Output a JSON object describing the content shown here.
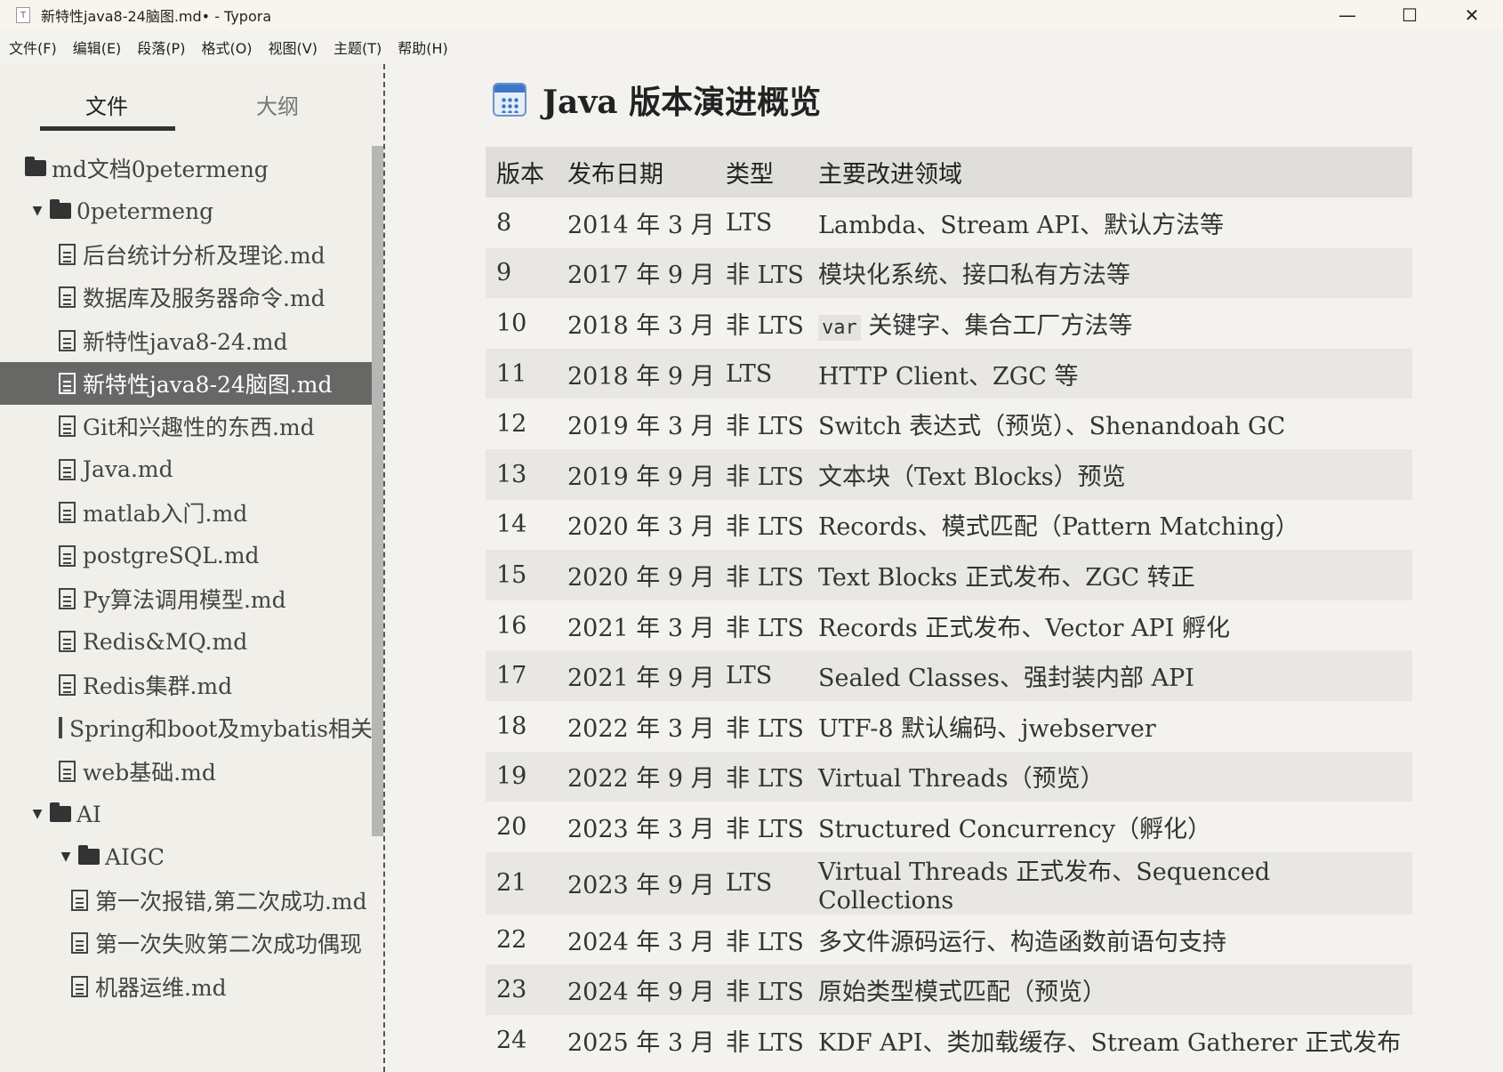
{
  "window": {
    "icon_letter": "T",
    "title": "新特性java8-24脑图.md• - Typora",
    "minimize": "—",
    "maximize": "☐",
    "close": "✕"
  },
  "menu": [
    "文件(F)",
    "编辑(E)",
    "段落(P)",
    "格式(O)",
    "视图(V)",
    "主题(T)",
    "帮助(H)"
  ],
  "sidebar": {
    "tabs": {
      "files": "文件",
      "outline": "大纲"
    },
    "tree": [
      {
        "type": "folder",
        "level": 0,
        "caret": "",
        "label": "md文档0petermeng"
      },
      {
        "type": "folder",
        "level": 1,
        "caret": "▼",
        "label": "0petermeng"
      },
      {
        "type": "file",
        "level": 2,
        "label": "后台统计分析及理论.md"
      },
      {
        "type": "file",
        "level": 2,
        "label": "数据库及服务器命令.md"
      },
      {
        "type": "file",
        "level": 2,
        "label": "新特性java8-24.md"
      },
      {
        "type": "file",
        "level": 2,
        "label": "新特性java8-24脑图.md",
        "selected": true
      },
      {
        "type": "file",
        "level": 2,
        "label": "Git和兴趣性的东西.md"
      },
      {
        "type": "file",
        "level": 2,
        "label": "Java.md"
      },
      {
        "type": "file",
        "level": 2,
        "label": "matlab入门.md"
      },
      {
        "type": "file",
        "level": 2,
        "label": "postgreSQL.md"
      },
      {
        "type": "file",
        "level": 2,
        "label": "Py算法调用模型.md"
      },
      {
        "type": "file",
        "level": 2,
        "label": "Redis&MQ.md"
      },
      {
        "type": "file",
        "level": 2,
        "label": "Redis集群.md"
      },
      {
        "type": "file",
        "level": 2,
        "label": "Spring和boot及mybatis相关"
      },
      {
        "type": "file",
        "level": 2,
        "label": "web基础.md"
      },
      {
        "type": "folder",
        "level": 1,
        "caret": "▼",
        "label": "AI"
      },
      {
        "type": "folder",
        "level": 2,
        "caret": "▼",
        "label": "AIGC"
      },
      {
        "type": "file",
        "level": 3,
        "label": "第一次报错,第二次成功.md"
      },
      {
        "type": "file",
        "level": 3,
        "label": "第一次失败第二次成功偶现"
      },
      {
        "type": "file",
        "level": 3,
        "label": "机器运维.md"
      }
    ]
  },
  "document": {
    "heading": "Java 版本演进概览",
    "table": {
      "headers": [
        "版本",
        "发布日期",
        "类型",
        "主要改进领域"
      ],
      "rows": [
        [
          "8",
          "2014 年 3 月",
          "LTS",
          "Lambda、Stream API、默认方法等"
        ],
        [
          "9",
          "2017 年 9 月",
          "非 LTS",
          "模块化系统、接口私有方法等"
        ],
        [
          "10",
          "2018 年 3 月",
          "非 LTS",
          "var|关键字、集合工厂方法等"
        ],
        [
          "11",
          "2018 年 9 月",
          "LTS",
          "HTTP Client、ZGC 等"
        ],
        [
          "12",
          "2019 年 3 月",
          "非 LTS",
          "Switch 表达式（预览）、Shenandoah GC"
        ],
        [
          "13",
          "2019 年 9 月",
          "非 LTS",
          "文本块（Text Blocks）预览"
        ],
        [
          "14",
          "2020 年 3 月",
          "非 LTS",
          "Records、模式匹配（Pattern Matching）"
        ],
        [
          "15",
          "2020 年 9 月",
          "非 LTS",
          "Text Blocks 正式发布、ZGC 转正"
        ],
        [
          "16",
          "2021 年 3 月",
          "非 LTS",
          "Records 正式发布、Vector API 孵化"
        ],
        [
          "17",
          "2021 年 9 月",
          "LTS",
          "Sealed Classes、强封装内部 API"
        ],
        [
          "18",
          "2022 年 3 月",
          "非 LTS",
          "UTF-8 默认编码、jwebserver"
        ],
        [
          "19",
          "2022 年 9 月",
          "非 LTS",
          "Virtual Threads（预览）"
        ],
        [
          "20",
          "2023 年 3 月",
          "非 LTS",
          "Structured Concurrency（孵化）"
        ],
        [
          "21",
          "2023 年 9 月",
          "LTS",
          "Virtual Threads 正式发布、Sequenced Collections"
        ],
        [
          "22",
          "2024 年 3 月",
          "非 LTS",
          "多文件源码运行、构造函数前语句支持"
        ],
        [
          "23",
          "2024 年 9 月",
          "非 LTS",
          "原始类型模式匹配（预览）"
        ],
        [
          "24",
          "2025 年 3 月",
          "非 LTS",
          "KDF API、类加载缓存、Stream Gatherer 正式发布"
        ]
      ]
    }
  }
}
